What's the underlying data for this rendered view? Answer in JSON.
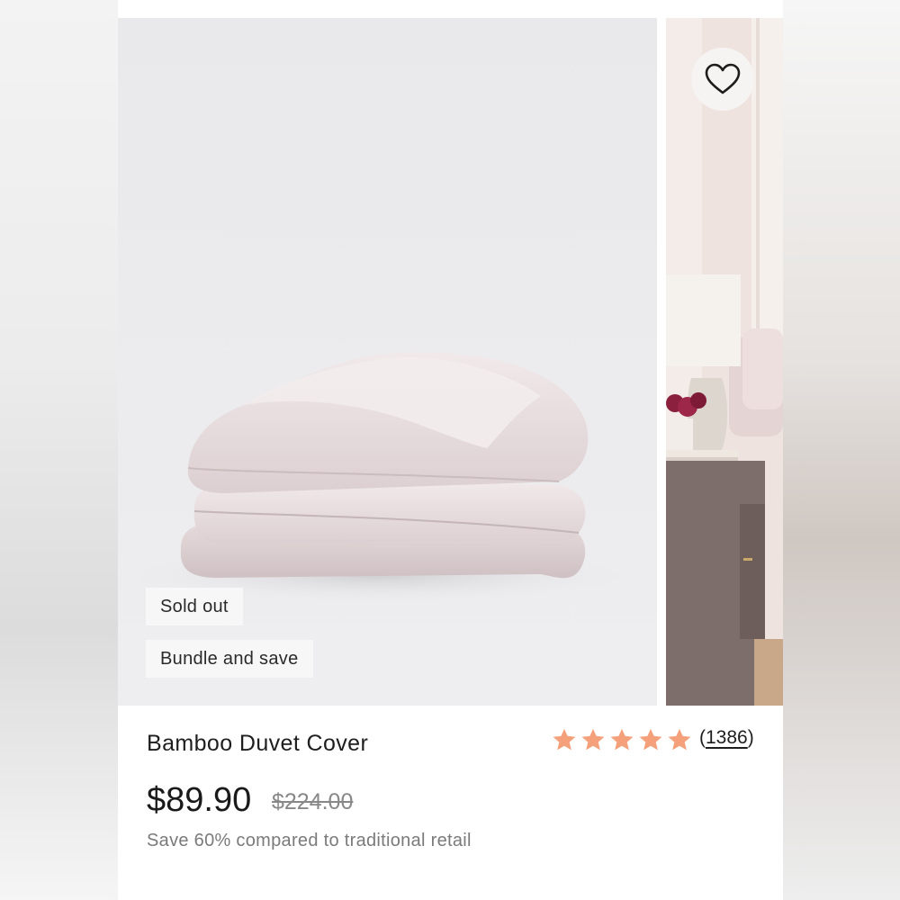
{
  "product": {
    "title": "Bamboo Duvet Cover",
    "price": "$89.90",
    "compare_price": "$224.00",
    "savings_text": "Save 60% compared to traditional retail",
    "rating": 5,
    "review_count_open": "(",
    "review_count": "1386",
    "review_count_close": ")"
  },
  "badges": {
    "sold_out": "Sold out",
    "bundle": "Bundle and save"
  },
  "icons": {
    "wishlist": "heart-icon",
    "rating_star": "star-icon"
  },
  "colors": {
    "star": "#f4a07a",
    "duvet": "#dccfd1",
    "nightstand": "#7e6e6b"
  }
}
